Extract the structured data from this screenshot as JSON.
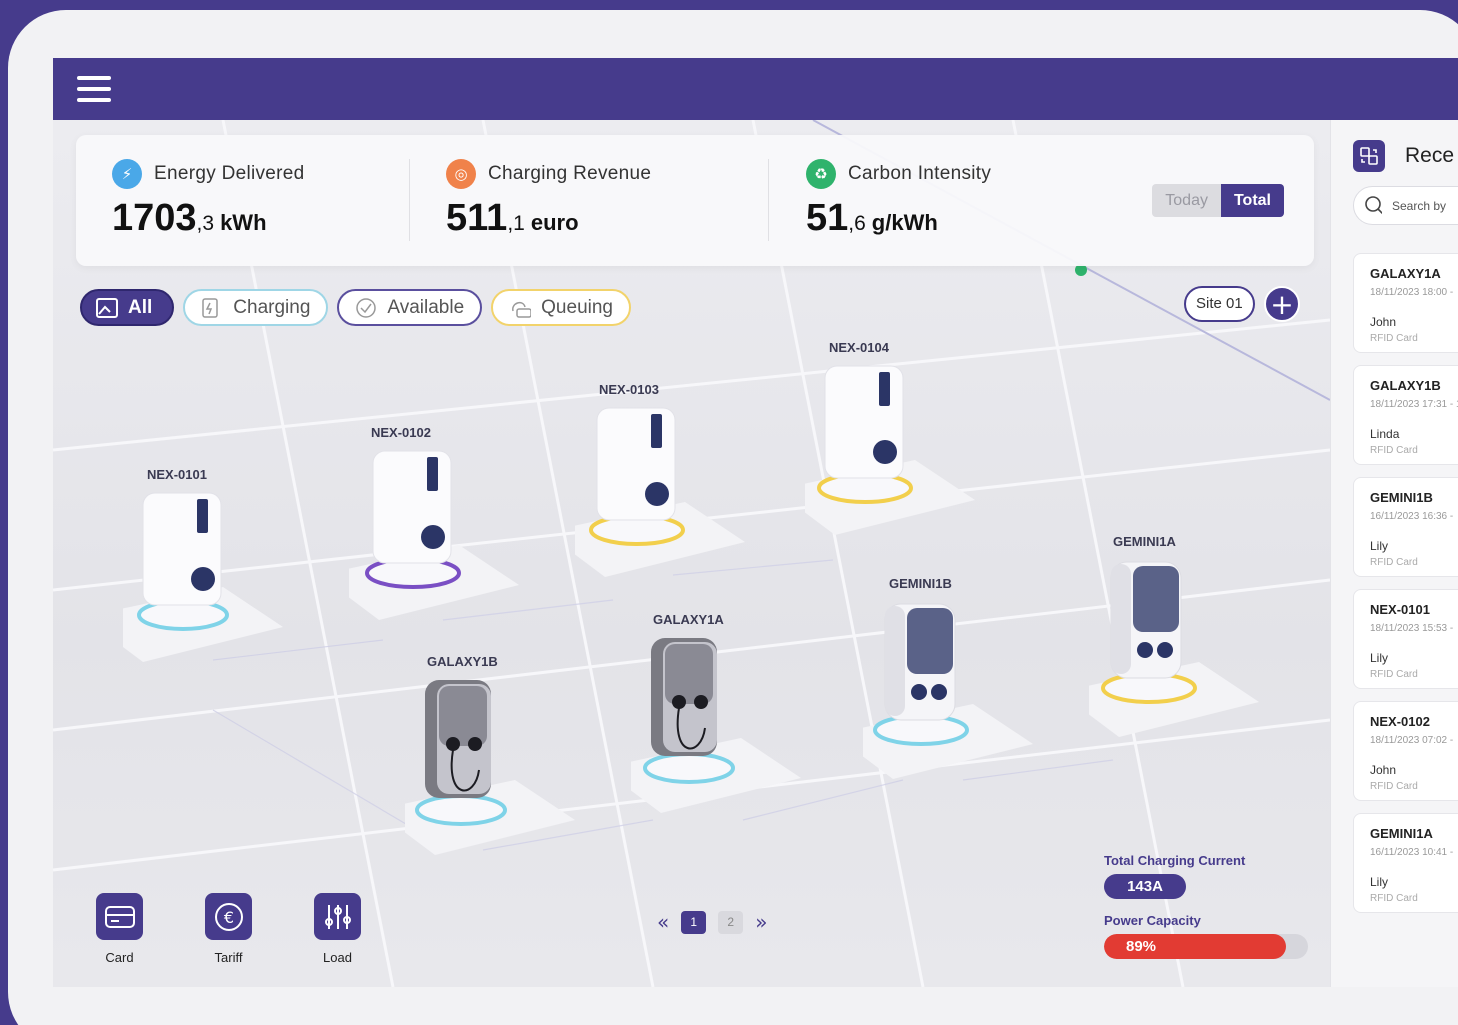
{
  "stats": {
    "energy": {
      "label": "Energy Delivered",
      "value": "1703",
      "decimal": ",3",
      "unit": "kWh",
      "color": "#4aa8e8"
    },
    "revenue": {
      "label": "Charging Revenue",
      "value": "511",
      "decimal": ",1",
      "unit": "euro",
      "color": "#f0824a"
    },
    "carbon": {
      "label": "Carbon Intensity",
      "value": "51",
      "decimal": ",6",
      "unit": "g/kWh",
      "color": "#2fb36c"
    },
    "toggle": {
      "today": "Today",
      "total": "Total",
      "selected": "Total"
    }
  },
  "filters": {
    "all": "All",
    "charging": "Charging",
    "available": "Available",
    "queuing": "Queuing"
  },
  "site": {
    "label": "Site 01",
    "add": "+"
  },
  "stations": [
    {
      "name": "NEX-0101",
      "type": "nex",
      "ring": "#7fd3e8"
    },
    {
      "name": "NEX-0102",
      "type": "nex",
      "ring": "#7a4fc4"
    },
    {
      "name": "NEX-0103",
      "type": "nex",
      "ring": "#f2cf4c"
    },
    {
      "name": "NEX-0104",
      "type": "nex",
      "ring": "#f2cf4c"
    },
    {
      "name": "GALAXY1B",
      "type": "galaxy",
      "ring": "#7fd3e8"
    },
    {
      "name": "GALAXY1A",
      "type": "galaxy",
      "ring": "#7fd3e8"
    },
    {
      "name": "GEMINI1B",
      "type": "gemini",
      "ring": "#7fd3e8"
    },
    {
      "name": "GEMINI1A",
      "type": "gemini",
      "ring": "#f2cf4c"
    }
  ],
  "tools": {
    "card": "Card",
    "tariff": "Tariff",
    "load": "Load"
  },
  "pager": {
    "prev": "«",
    "next": "»",
    "page1": "1",
    "page2": "2",
    "current": 1
  },
  "gauges": {
    "current_label": "Total Charging Current",
    "current_value": "143A",
    "capacity_label": "Power Capacity",
    "capacity_value": "89%",
    "capacity_fraction": 0.89
  },
  "panel": {
    "title": "Rece",
    "search_placeholder": "Search by",
    "transactions": [
      {
        "name": "GALAXY1A",
        "date": "18/11/2023 18:00 -",
        "user": "John",
        "method": "RFID Card"
      },
      {
        "name": "GALAXY1B",
        "date": "18/11/2023 17:31 - 1",
        "user": "Linda",
        "method": "RFID Card"
      },
      {
        "name": "GEMINI1B",
        "date": "16/11/2023 16:36 -",
        "user": "Lily",
        "method": "RFID Card"
      },
      {
        "name": "NEX-0101",
        "date": "18/11/2023 15:53 -",
        "user": "Lily",
        "method": "RFID Card"
      },
      {
        "name": "NEX-0102",
        "date": "18/11/2023 07:02 -",
        "user": "John",
        "method": "RFID Card"
      },
      {
        "name": "GEMINI1A",
        "date": "16/11/2023 10:41 -",
        "user": "Lily",
        "method": "RFID Card"
      }
    ]
  },
  "colors": {
    "brand": "#463b8c",
    "danger": "#e23b33"
  }
}
